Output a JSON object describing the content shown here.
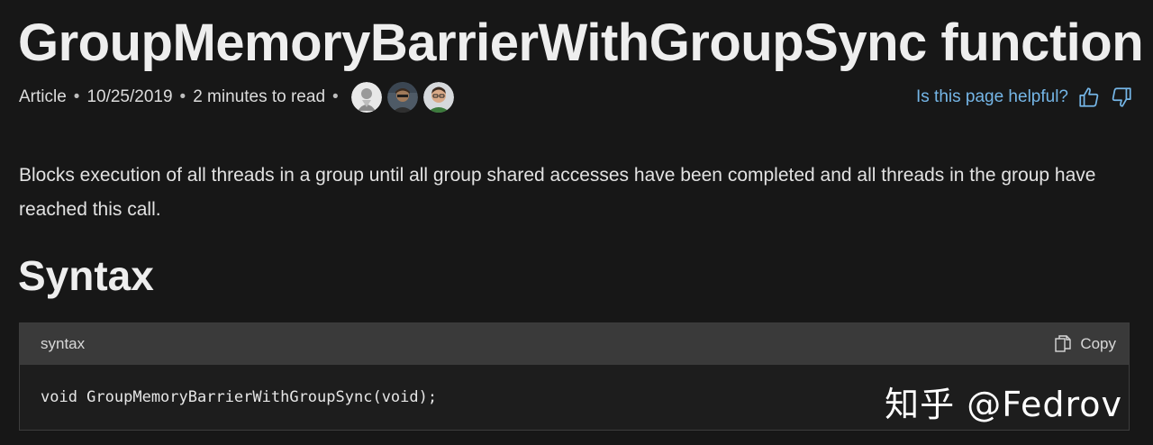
{
  "page": {
    "title": "GroupMemoryBarrierWithGroupSync function",
    "meta": {
      "type": "Article",
      "date": "10/25/2019",
      "read_time": "2 minutes to read",
      "separator": "•"
    },
    "helpful": {
      "question": "Is this page helpful?",
      "thumbs_up_icon": "thumbs-up-icon",
      "thumbs_down_icon": "thumbs-down-icon"
    },
    "description": "Blocks execution of all threads in a group until all group shared accesses have been completed and all threads in the group have reached this call.",
    "syntax_heading": "Syntax",
    "code_block": {
      "language_label": "syntax",
      "copy_label": "Copy",
      "copy_icon": "copy-icon",
      "code": "void GroupMemoryBarrierWithGroupSync(void);"
    },
    "watermark": "知乎 @Fedrov"
  },
  "colors": {
    "background": "#171717",
    "link": "#75b6e7",
    "code_header": "#3a3a3a",
    "code_body": "#1d1d1d"
  }
}
